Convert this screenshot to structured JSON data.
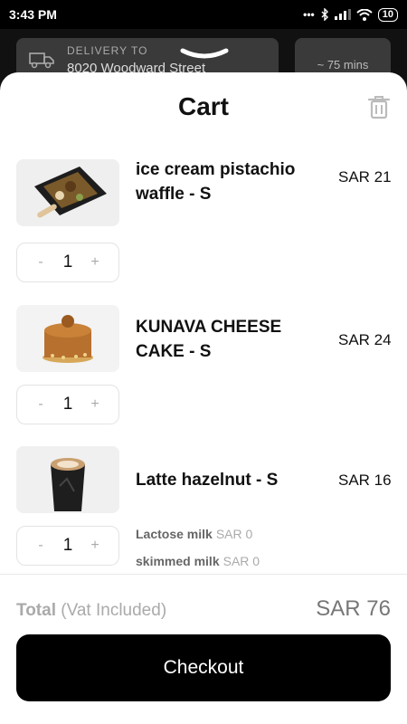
{
  "status_bar": {
    "time": "3:43 PM",
    "icons_text": "... ",
    "battery": "10"
  },
  "header": {
    "delivery_label": "DELIVERY TO",
    "delivery_address": "8020 Woodward Street",
    "eta": "~ 75 mins"
  },
  "cart": {
    "title": "Cart",
    "items": [
      {
        "name": "ice cream pistachio waffle - S",
        "price": "SAR 21",
        "quantity": "1",
        "minus": "-",
        "plus": "+"
      },
      {
        "name": "KUNAVA CHEESE CAKE - S",
        "price": "SAR 24",
        "quantity": "1",
        "minus": "-",
        "plus": "+"
      },
      {
        "name": "Latte hazelnut - S",
        "price": "SAR 16",
        "quantity": "1",
        "minus": "-",
        "plus": "+",
        "modifiers": [
          {
            "name": "Lactose milk",
            "price": "SAR 0"
          },
          {
            "name": "skimmed milk",
            "price": "SAR 0"
          }
        ]
      }
    ]
  },
  "footer": {
    "total_label": "Total",
    "total_sub": "(Vat Included)",
    "total_value": "SAR 76",
    "checkout_label": "Checkout"
  },
  "icons": {
    "delivery": "truck-icon",
    "trash": "trash-icon",
    "handle": "chevron-down-icon"
  }
}
